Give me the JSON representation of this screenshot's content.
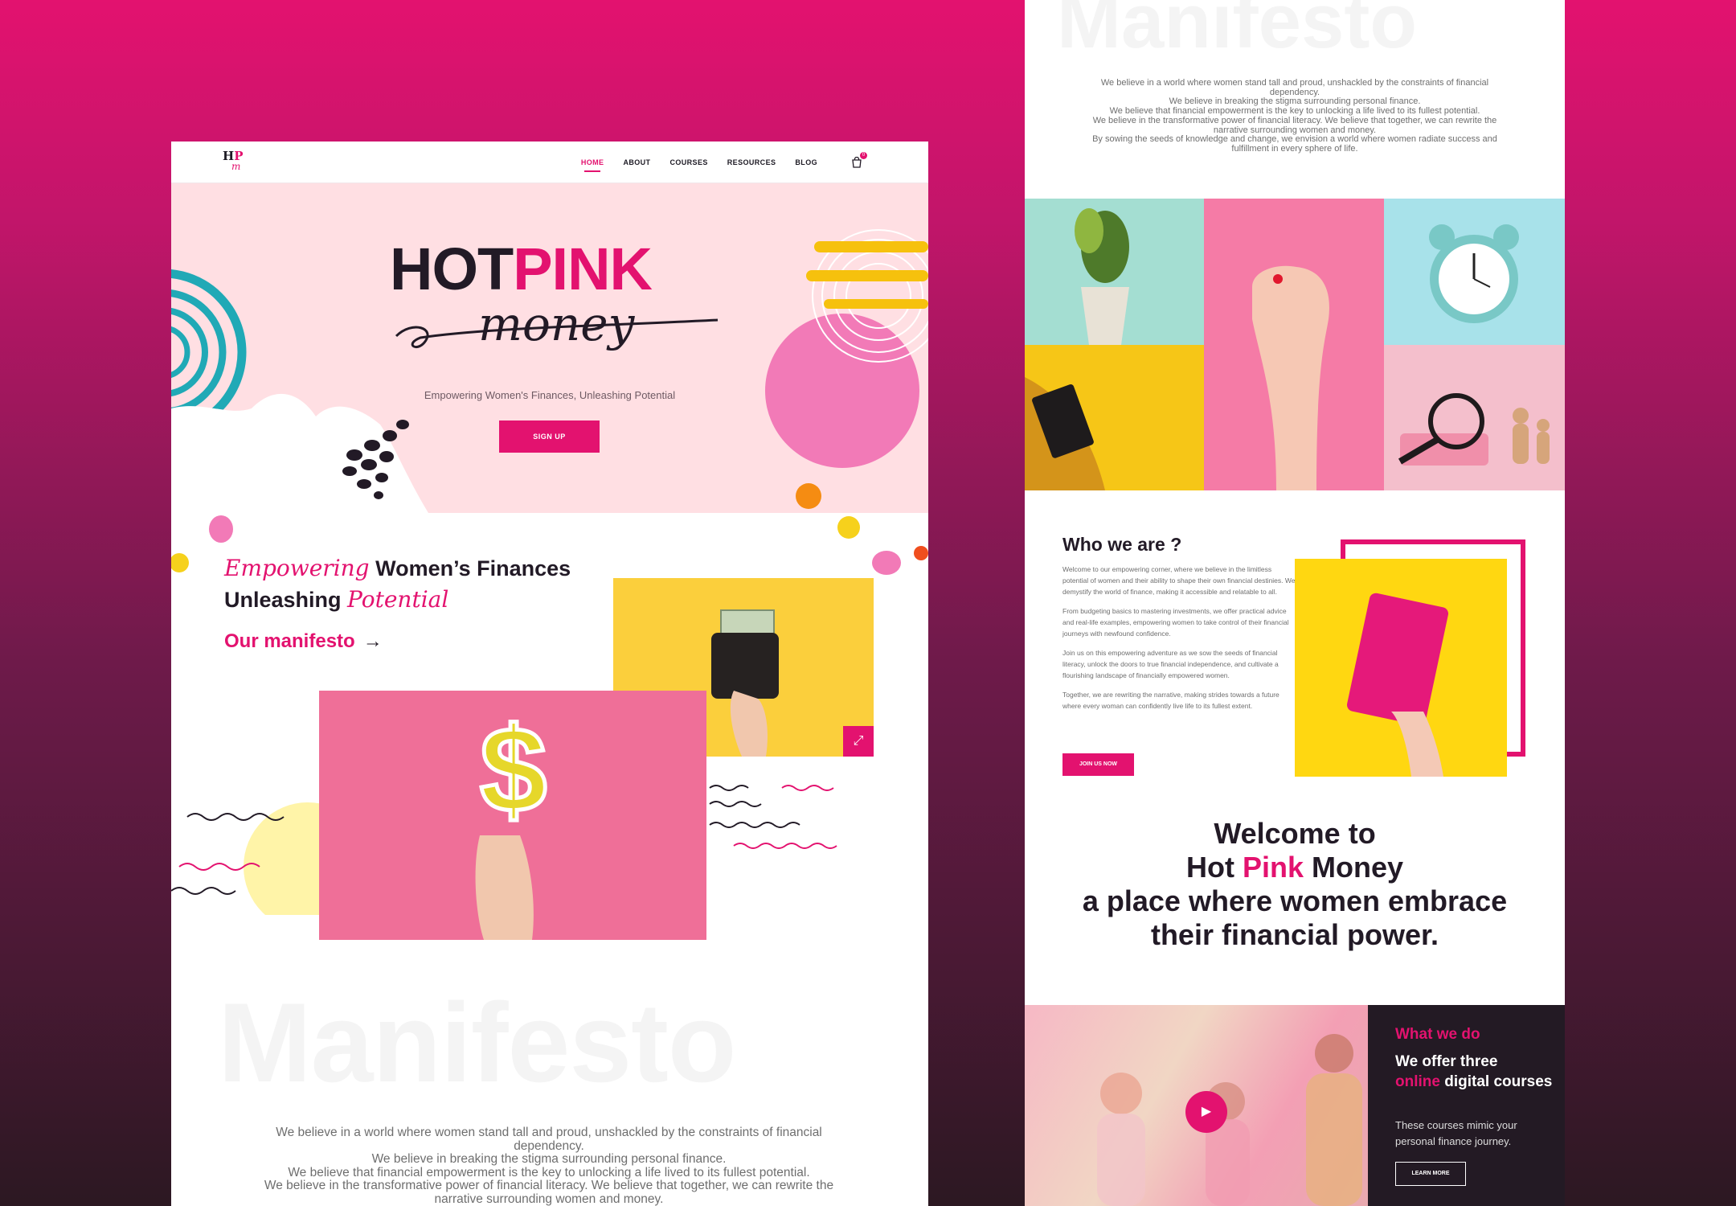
{
  "colors": {
    "accent": "#e3126f",
    "dark": "#221a26",
    "hero_bg": "#ffdfe3",
    "yellow": "#fbcf3c"
  },
  "nav": {
    "logo": {
      "h": "H",
      "p": "P",
      "m": "m"
    },
    "items": [
      "HOME",
      "ABOUT",
      "COURSES",
      "RESOURCES",
      "BLOG"
    ],
    "active": "HOME",
    "cart_count": "0",
    "cart_icon": "shopping-bag-icon"
  },
  "hero": {
    "title_hot": "HOT",
    "title_pink": "PINK",
    "title_script": "money",
    "subtitle": "Empowering Women's Finances, Unleashing Potential",
    "signup_label": "SIGN UP"
  },
  "intro": {
    "script1": "Empowering",
    "line1_rest": " Women’s Finances",
    "line2_start": "Unleashing ",
    "script2": "Potential",
    "manifesto_link": "Our manifesto",
    "arrow": "→"
  },
  "manifesto": {
    "bg_word": "Manifesto",
    "lines_left": [
      "We believe in a world where women stand tall and proud, unshackled by the constraints of financial",
      "dependency.",
      "We believe in breaking the stigma surrounding personal finance.",
      "We believe that financial empowerment is the key to unlocking a life lived to its fullest potential.",
      "We believe in the transformative power of financial literacy. We believe that together, we can rewrite the",
      "narrative surrounding women and money."
    ],
    "lines_right": [
      "We believe in a world where women stand tall and proud, unshackled by the constraints of financial",
      "dependency.",
      "We believe in breaking the stigma surrounding personal finance.",
      "We believe that financial empowerment is the key to unlocking a life lived to its fullest potential.",
      "We believe in the transformative power of financial literacy. We believe that together, we can rewrite the",
      "narrative surrounding women and money.",
      "By sowing the seeds of knowledge and change, we envision a world where women radiate success and",
      "fulfillment in every sphere of life."
    ]
  },
  "who": {
    "title": "Who we are ?",
    "paragraphs": [
      "Welcome to our empowering corner, where we believe in the limitless potential of women and their ability to shape their own financial destinies. We demystify the world of finance, making it accessible and relatable to all.",
      "From budgeting basics to mastering investments, we offer practical advice and real-life examples, empowering women to take control of their financial journeys with newfound confidence.",
      "Join us on this empowering adventure as we sow the seeds of financial literacy, unlock the doors to true financial independence, and cultivate a flourishing landscape of financially empowered women.",
      "Together, we are rewriting the narrative, making strides towards a future where every woman can confidently live life to its fullest extent."
    ],
    "join_label": "JOIN US NOW"
  },
  "welcome": {
    "line1": "Welcome to",
    "hot": "Hot ",
    "pink": "Pink",
    "money": " Money",
    "line3": "a place where women embrace",
    "line4": "their financial power."
  },
  "what_we_do": {
    "title": "What we do",
    "head_1": "We offer three",
    "head_pink": "online",
    "head_2": " digital courses",
    "desc": "These courses mimic your personal finance journey.",
    "learn_label": "LEARN MORE",
    "play_icon": "play-icon"
  }
}
